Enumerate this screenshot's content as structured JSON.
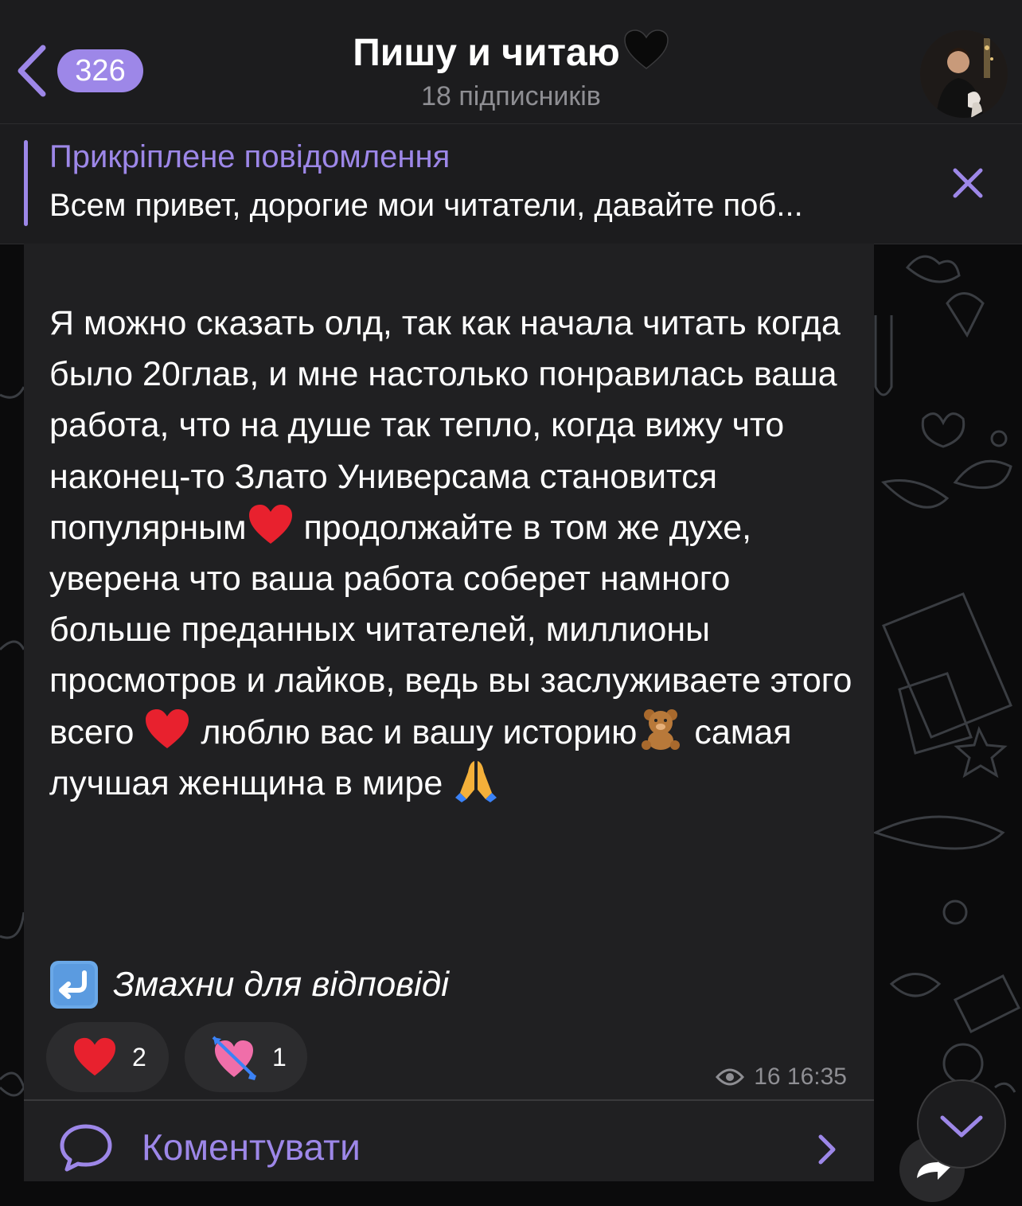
{
  "header": {
    "back_count": "326",
    "title": "Пишу и читаю",
    "subtitle": "18 підписників"
  },
  "pinned": {
    "title": "Прикріплене повідомлення",
    "text": "Всем привет, дорогие мои читатели, давайте поб..."
  },
  "message": {
    "segments": [
      "Я можно сказать олд, так как начала читать когда было 20глав, и мне настолько понравилась ваша работа, что на душе так тепло, когда вижу что наконец-то Злато Универсама становится популярным",
      " продолжайте в том же духе, уверена что ваша работа соберет намного больше преданных читателей, миллионы просмотров и лайков, ведь вы заслуживаете этого всего ",
      " люблю вас и вашу историю",
      " самая лучшая женщина в мире "
    ],
    "emojis": [
      "red-heart-icon",
      "red-heart-icon",
      "teddy-bear-icon",
      "folded-hands-icon"
    ],
    "swipe_hint": "Змахни для відповіді",
    "reactions": [
      {
        "icon": "red-heart-icon",
        "count": "2"
      },
      {
        "icon": "heart-with-arrow-icon",
        "count": "1"
      }
    ],
    "views_time": "16 16:35"
  },
  "comments": {
    "label": "Коментувати"
  },
  "colors": {
    "accent": "#9d87e8",
    "header_bg": "#1c1c1e",
    "bubble_bg": "#202022",
    "secondary_text": "#8e8e93"
  }
}
